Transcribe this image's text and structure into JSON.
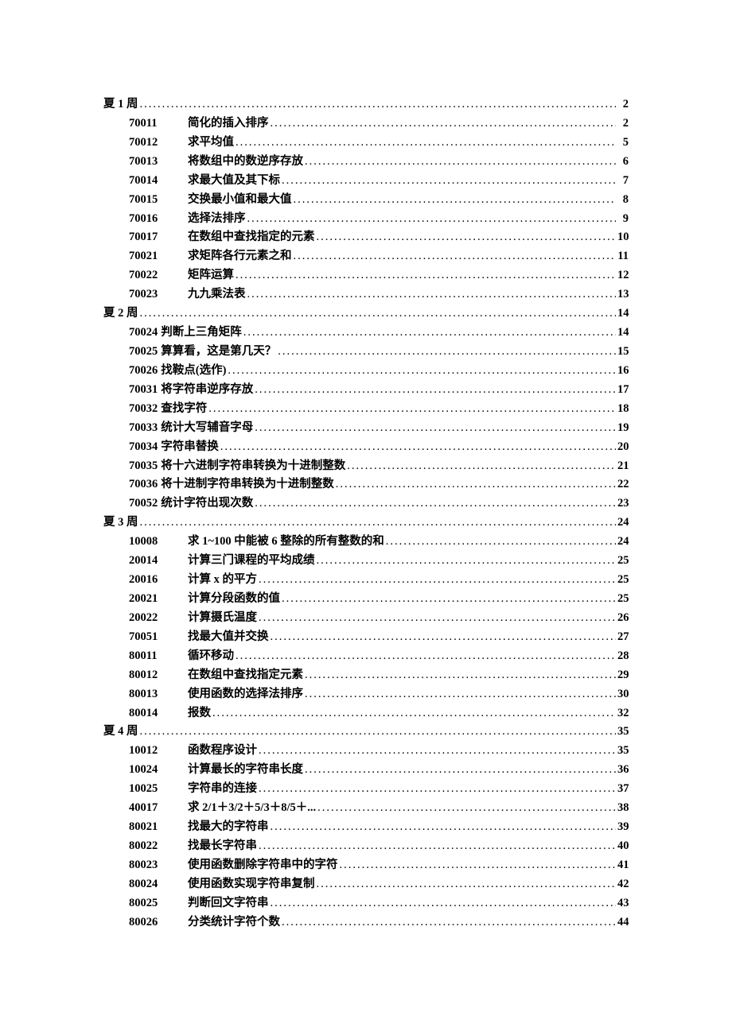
{
  "sections": [
    {
      "title": "夏 1 周",
      "page": "2",
      "inlineCode": false,
      "items": [
        {
          "code": "70011",
          "title": "简化的插入排序",
          "page": "2"
        },
        {
          "code": "70012",
          "title": "求平均值",
          "page": "5"
        },
        {
          "code": "70013",
          "title": "将数组中的数逆序存放",
          "page": "6"
        },
        {
          "code": "70014",
          "title": "求最大值及其下标",
          "page": "7"
        },
        {
          "code": "70015",
          "title": "交换最小值和最大值",
          "page": "8"
        },
        {
          "code": "70016",
          "title": "选择法排序",
          "page": "9"
        },
        {
          "code": "70017",
          "title": "在数组中查找指定的元素",
          "page": "10"
        },
        {
          "code": "70021",
          "title": "求矩阵各行元素之和",
          "page": "11"
        },
        {
          "code": "70022",
          "title": "矩阵运算",
          "page": "12"
        },
        {
          "code": "70023",
          "title": "九九乘法表",
          "page": "13"
        }
      ]
    },
    {
      "title": "夏 2 周",
      "page": "14",
      "inlineCode": true,
      "items": [
        {
          "code": "70024",
          "title": "判断上三角矩阵",
          "page": "14"
        },
        {
          "code": "70025",
          "title": "算算看，这是第几天？",
          "page": "15"
        },
        {
          "code": "70026",
          "title": "找鞍点(选作)",
          "page": "16"
        },
        {
          "code": "70031",
          "title": "将字符串逆序存放",
          "page": "17"
        },
        {
          "code": "70032",
          "title": "查找字符",
          "page": "18"
        },
        {
          "code": "70033",
          "title": "统计大写辅音字母",
          "page": "19"
        },
        {
          "code": "70034",
          "title": "字符串替换",
          "page": "20"
        },
        {
          "code": "70035",
          "title": "将十六进制字符串转换为十进制整数",
          "page": "21"
        },
        {
          "code": "70036",
          "title": "将十进制字符串转换为十进制整数",
          "page": "22"
        },
        {
          "code": "70052",
          "title": "统计字符出现次数",
          "page": "23"
        }
      ]
    },
    {
      "title": "夏 3 周",
      "page": "24",
      "inlineCode": false,
      "items": [
        {
          "code": "10008",
          "title": "求 1~100 中能被 6 整除的所有整数的和",
          "page": "24"
        },
        {
          "code": "20014",
          "title": "计算三门课程的平均成绩",
          "page": "25"
        },
        {
          "code": "20016",
          "title": "计算 x 的平方",
          "page": "25"
        },
        {
          "code": "20021",
          "title": "计算分段函数的值",
          "page": "25"
        },
        {
          "code": "20022",
          "title": "计算摄氏温度",
          "page": "26"
        },
        {
          "code": "70051",
          "title": "找最大值并交换",
          "page": "27"
        },
        {
          "code": "80011",
          "title": "循环移动",
          "page": "28"
        },
        {
          "code": "80012",
          "title": "在数组中查找指定元素",
          "page": "29"
        },
        {
          "code": "80013",
          "title": "使用函数的选择法排序",
          "page": "30"
        },
        {
          "code": "80014",
          "title": "报数",
          "page": "32"
        }
      ]
    },
    {
      "title": "夏 4 周",
      "page": "35",
      "inlineCode": false,
      "items": [
        {
          "code": "10012",
          "title": "函数程序设计",
          "page": "35"
        },
        {
          "code": "10024",
          "title": "计算最长的字符串长度",
          "page": "36"
        },
        {
          "code": "10025",
          "title": "字符串的连接",
          "page": "37"
        },
        {
          "code": "40017",
          "title": "求 2/1＋3/2＋5/3＋8/5＋...",
          "page": "38"
        },
        {
          "code": "80021",
          "title": "找最大的字符串",
          "page": "39"
        },
        {
          "code": "80022",
          "title": "找最长字符串",
          "page": "40"
        },
        {
          "code": "80023",
          "title": "使用函数删除字符串中的字符",
          "page": "41"
        },
        {
          "code": "80024",
          "title": "使用函数实现字符串复制",
          "page": "42"
        },
        {
          "code": "80025",
          "title": "判断回文字符串",
          "page": "43"
        },
        {
          "code": "80026",
          "title": "分类统计字符个数",
          "page": "44"
        }
      ]
    }
  ]
}
